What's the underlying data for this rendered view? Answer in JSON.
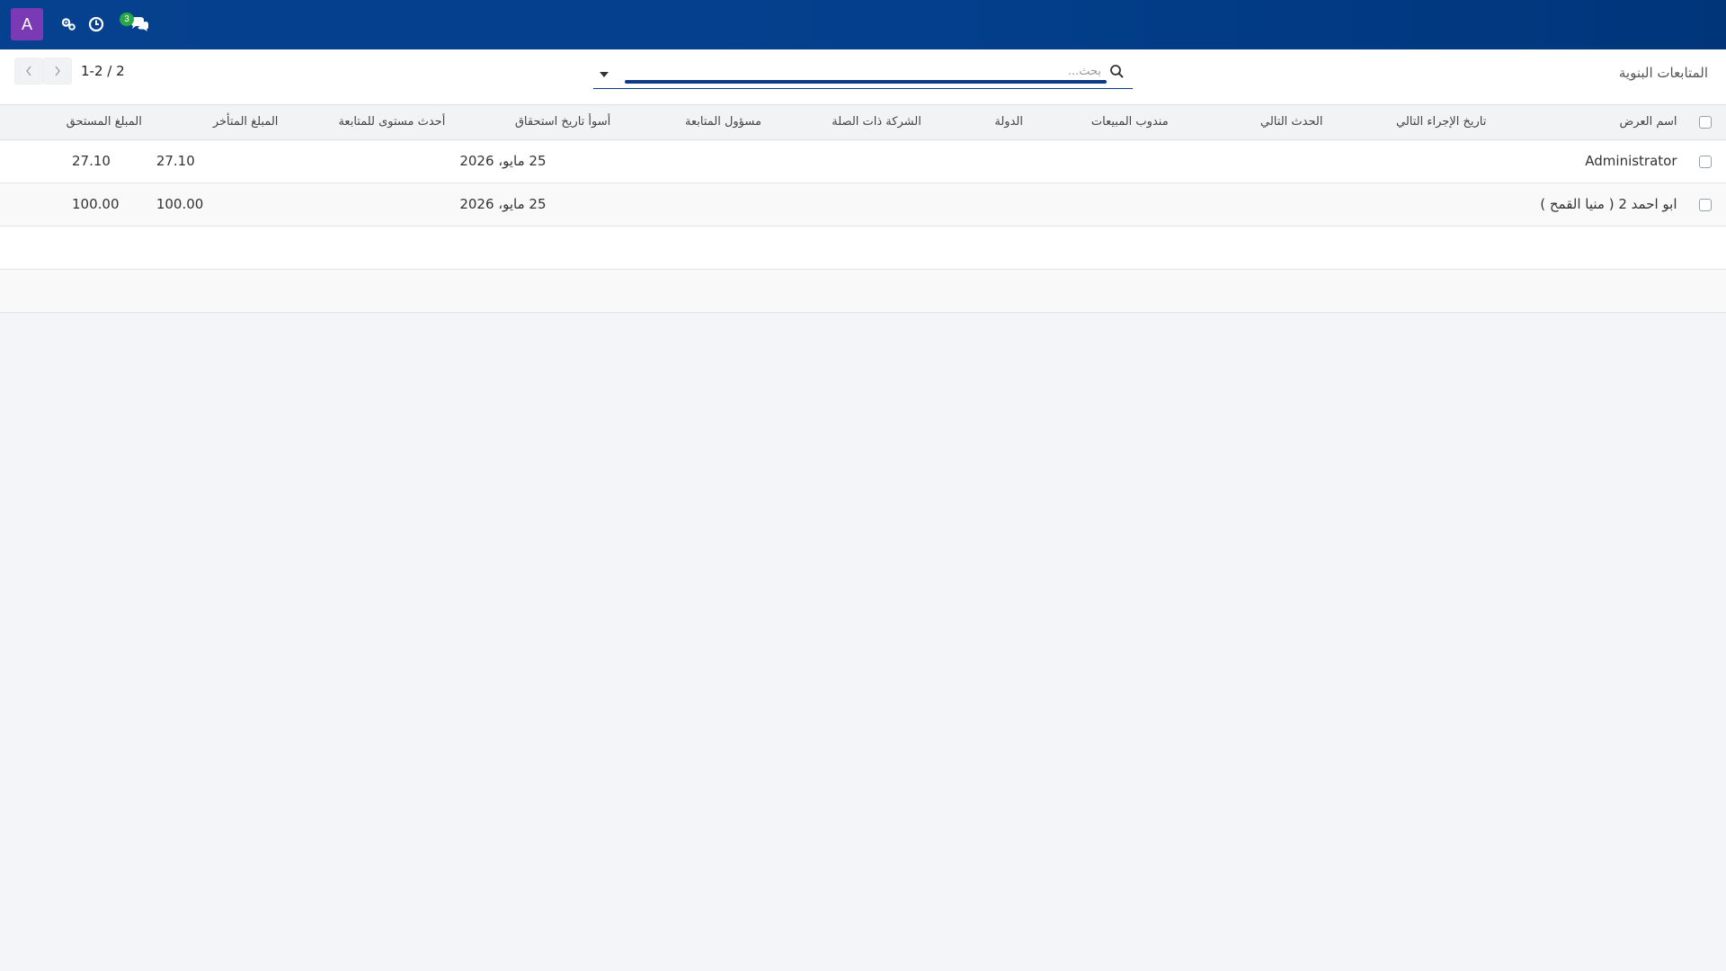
{
  "navbar": {
    "avatar_letter": "A",
    "badge_count": "3",
    "icons": [
      "avatar",
      "settings-gears-icon",
      "clock-icon",
      "chat-icon"
    ]
  },
  "control_panel": {
    "breadcrumb": "المتابعات البنوية",
    "search_placeholder": "بحث...",
    "pager_value": "1-2 / 2"
  },
  "table": {
    "columns": [
      "اسم العرض",
      "تاريخ الإجراء التالي",
      "الحدث التالي",
      "مندوب المبيعات",
      "الدولة",
      "الشركة ذات الصلة",
      "مسؤول المتابعة",
      "أسوأ تاريخ استحقاق",
      "أحدث مستوى للمتابعة",
      "المبلغ المتأخر",
      "المبلغ المستحق"
    ],
    "rows": [
      {
        "display_name": "Administrator",
        "worst_due_date": "25 مايو، 2026",
        "overdue_amount": "27.10",
        "due_amount": "27.10"
      },
      {
        "display_name": "ابو احمد 2 ( منيا القمح )",
        "worst_due_date": "25 مايو، 2026",
        "overdue_amount": "100.00",
        "due_amount": "100.00"
      }
    ]
  },
  "colors": {
    "navbar": "#06418f",
    "avatar": "#7a3ab5",
    "badge": "#28a745"
  }
}
